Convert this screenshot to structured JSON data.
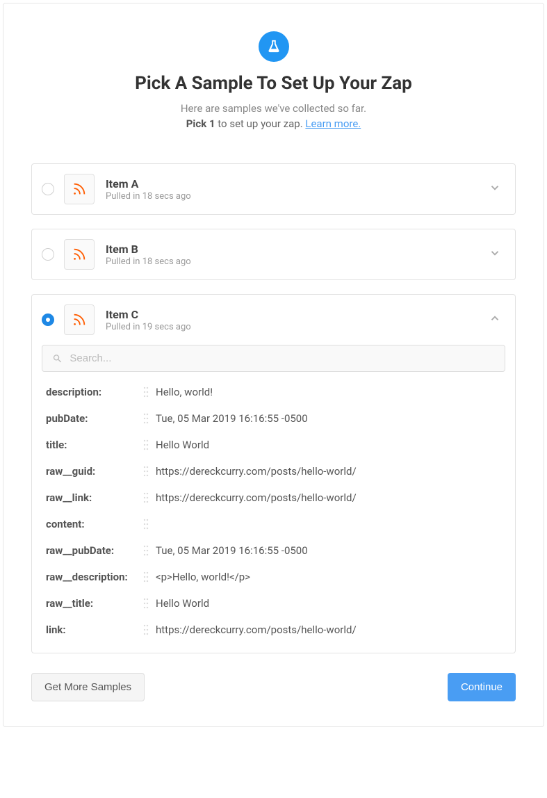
{
  "header": {
    "title": "Pick A Sample To Set Up Your Zap",
    "subtitle": "Here are samples we've collected so far.",
    "instruction_bold": "Pick 1",
    "instruction_rest": " to set up your zap. ",
    "learn_more": "Learn more."
  },
  "samples": [
    {
      "name": "Item A",
      "meta": "Pulled in 18 secs ago",
      "selected": false,
      "expanded": false
    },
    {
      "name": "Item B",
      "meta": "Pulled in 18 secs ago",
      "selected": false,
      "expanded": false
    },
    {
      "name": "Item C",
      "meta": "Pulled in 19 secs ago",
      "selected": true,
      "expanded": true
    }
  ],
  "search": {
    "placeholder": "Search..."
  },
  "fields": [
    {
      "key": "description:",
      "value": "Hello, world!"
    },
    {
      "key": "pubDate:",
      "value": "Tue, 05 Mar 2019 16:16:55 -0500"
    },
    {
      "key": "title:",
      "value": "Hello World"
    },
    {
      "key": "raw__guid:",
      "value": "https://dereckcurry.com/posts/hello-world/"
    },
    {
      "key": "raw__link:",
      "value": "https://dereckcurry.com/posts/hello-world/"
    },
    {
      "key": "content:",
      "value": ""
    },
    {
      "key": "raw__pubDate:",
      "value": "Tue, 05 Mar 2019 16:16:55 -0500"
    },
    {
      "key": "raw__description:",
      "value": "<p>Hello, world!</p>"
    },
    {
      "key": "raw__title:",
      "value": "Hello World"
    },
    {
      "key": "link:",
      "value": "https://dereckcurry.com/posts/hello-world/"
    }
  ],
  "footer": {
    "get_more": "Get More Samples",
    "continue": "Continue"
  }
}
